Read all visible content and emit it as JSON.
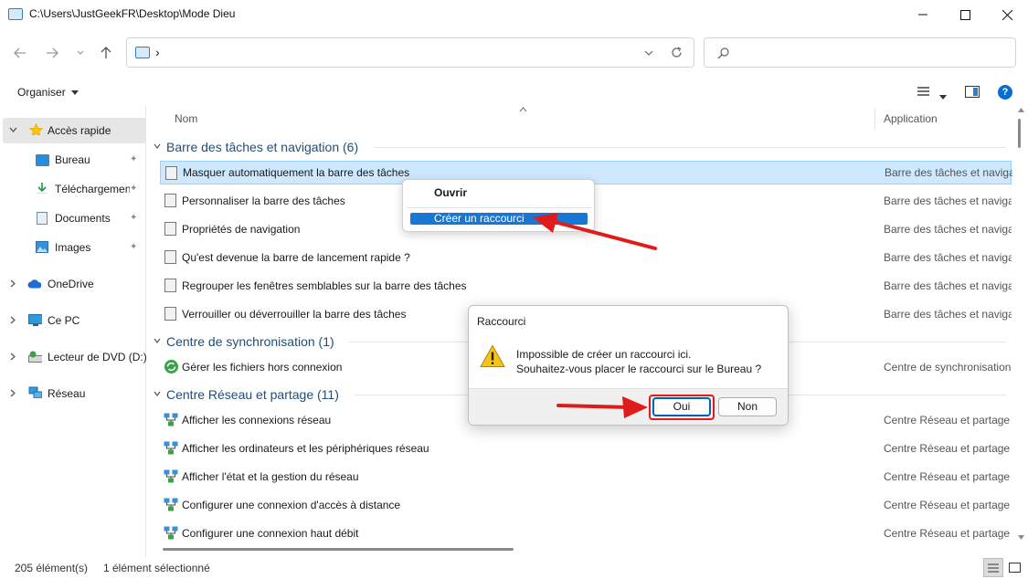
{
  "window": {
    "title": "C:\\Users\\JustGeekFR\\Desktop\\Mode Dieu",
    "address_suffix": "›"
  },
  "search": {
    "placeholder": ""
  },
  "toolbar": {
    "organiser_label": "Organiser"
  },
  "sidebar": {
    "items": [
      {
        "label": "Accès rapide",
        "icon": "star-icon",
        "selected": true
      },
      {
        "label": "Bureau",
        "icon": "desktop-icon",
        "pinned": true
      },
      {
        "label": "Téléchargements",
        "icon": "download-icon",
        "pinned": true
      },
      {
        "label": "Documents",
        "icon": "document-icon",
        "pinned": true
      },
      {
        "label": "Images",
        "icon": "image-icon",
        "pinned": true
      },
      {
        "label": "OneDrive",
        "icon": "cloud-icon"
      },
      {
        "label": "Ce PC",
        "icon": "computer-icon"
      },
      {
        "label": "Lecteur de DVD (D:)",
        "icon": "dvd-icon"
      },
      {
        "label": "Réseau",
        "icon": "network-icon"
      }
    ]
  },
  "columns": {
    "name": "Nom",
    "application": "Application"
  },
  "groups": [
    {
      "title": "Barre des tâches et navigation (6)",
      "rows": [
        {
          "name": "Masquer automatiquement la barre des tâches",
          "app": "Barre des tâches et navigat",
          "selected": true
        },
        {
          "name": "Personnaliser la barre des tâches",
          "app": "Barre des tâches et navigat"
        },
        {
          "name": "Propriétés de navigation",
          "app": "Barre des tâches et navigat"
        },
        {
          "name": "Qu'est devenue la barre de lancement rapide ?",
          "app": "Barre des tâches et navigat"
        },
        {
          "name": "Regrouper les fenêtres semblables sur la barre des tâches",
          "app": "Barre des tâches et navigat"
        },
        {
          "name": "Verrouiller ou déverrouiller la barre des tâches",
          "app": "Barre des tâches et navigat"
        }
      ]
    },
    {
      "title": "Centre de synchronisation (1)",
      "rows": [
        {
          "name": "Gérer les fichiers hors connexion",
          "app": "Centre de synchronisation"
        }
      ]
    },
    {
      "title": "Centre Réseau et partage (11)",
      "rows": [
        {
          "name": "Afficher les connexions réseau",
          "app": "Centre Réseau et partage"
        },
        {
          "name": "Afficher les ordinateurs et les périphériques réseau",
          "app": "Centre Réseau et partage"
        },
        {
          "name": "Afficher l'état et la gestion du réseau",
          "app": "Centre Réseau et partage"
        },
        {
          "name": "Configurer une connexion d'accès à distance",
          "app": "Centre Réseau et partage"
        },
        {
          "name": "Configurer une connexion haut débit",
          "app": "Centre Réseau et partage"
        }
      ]
    }
  ],
  "context_menu": {
    "open": "Ouvrir",
    "create_shortcut": "Créer un raccourci"
  },
  "dialog": {
    "title": "Raccourci",
    "line1": "Impossible de créer un raccourci ici.",
    "line2": "Souhaitez-vous placer le raccourci sur le Bureau ?",
    "yes": "Oui",
    "no": "Non"
  },
  "status": {
    "count": "205 élément(s)",
    "selection": "1 élément sélectionné"
  },
  "colors": {
    "accent": "#1976d2",
    "selection": "#cde8ff",
    "annotation_red": "#e01b1b",
    "group_title": "#1f4e79"
  }
}
